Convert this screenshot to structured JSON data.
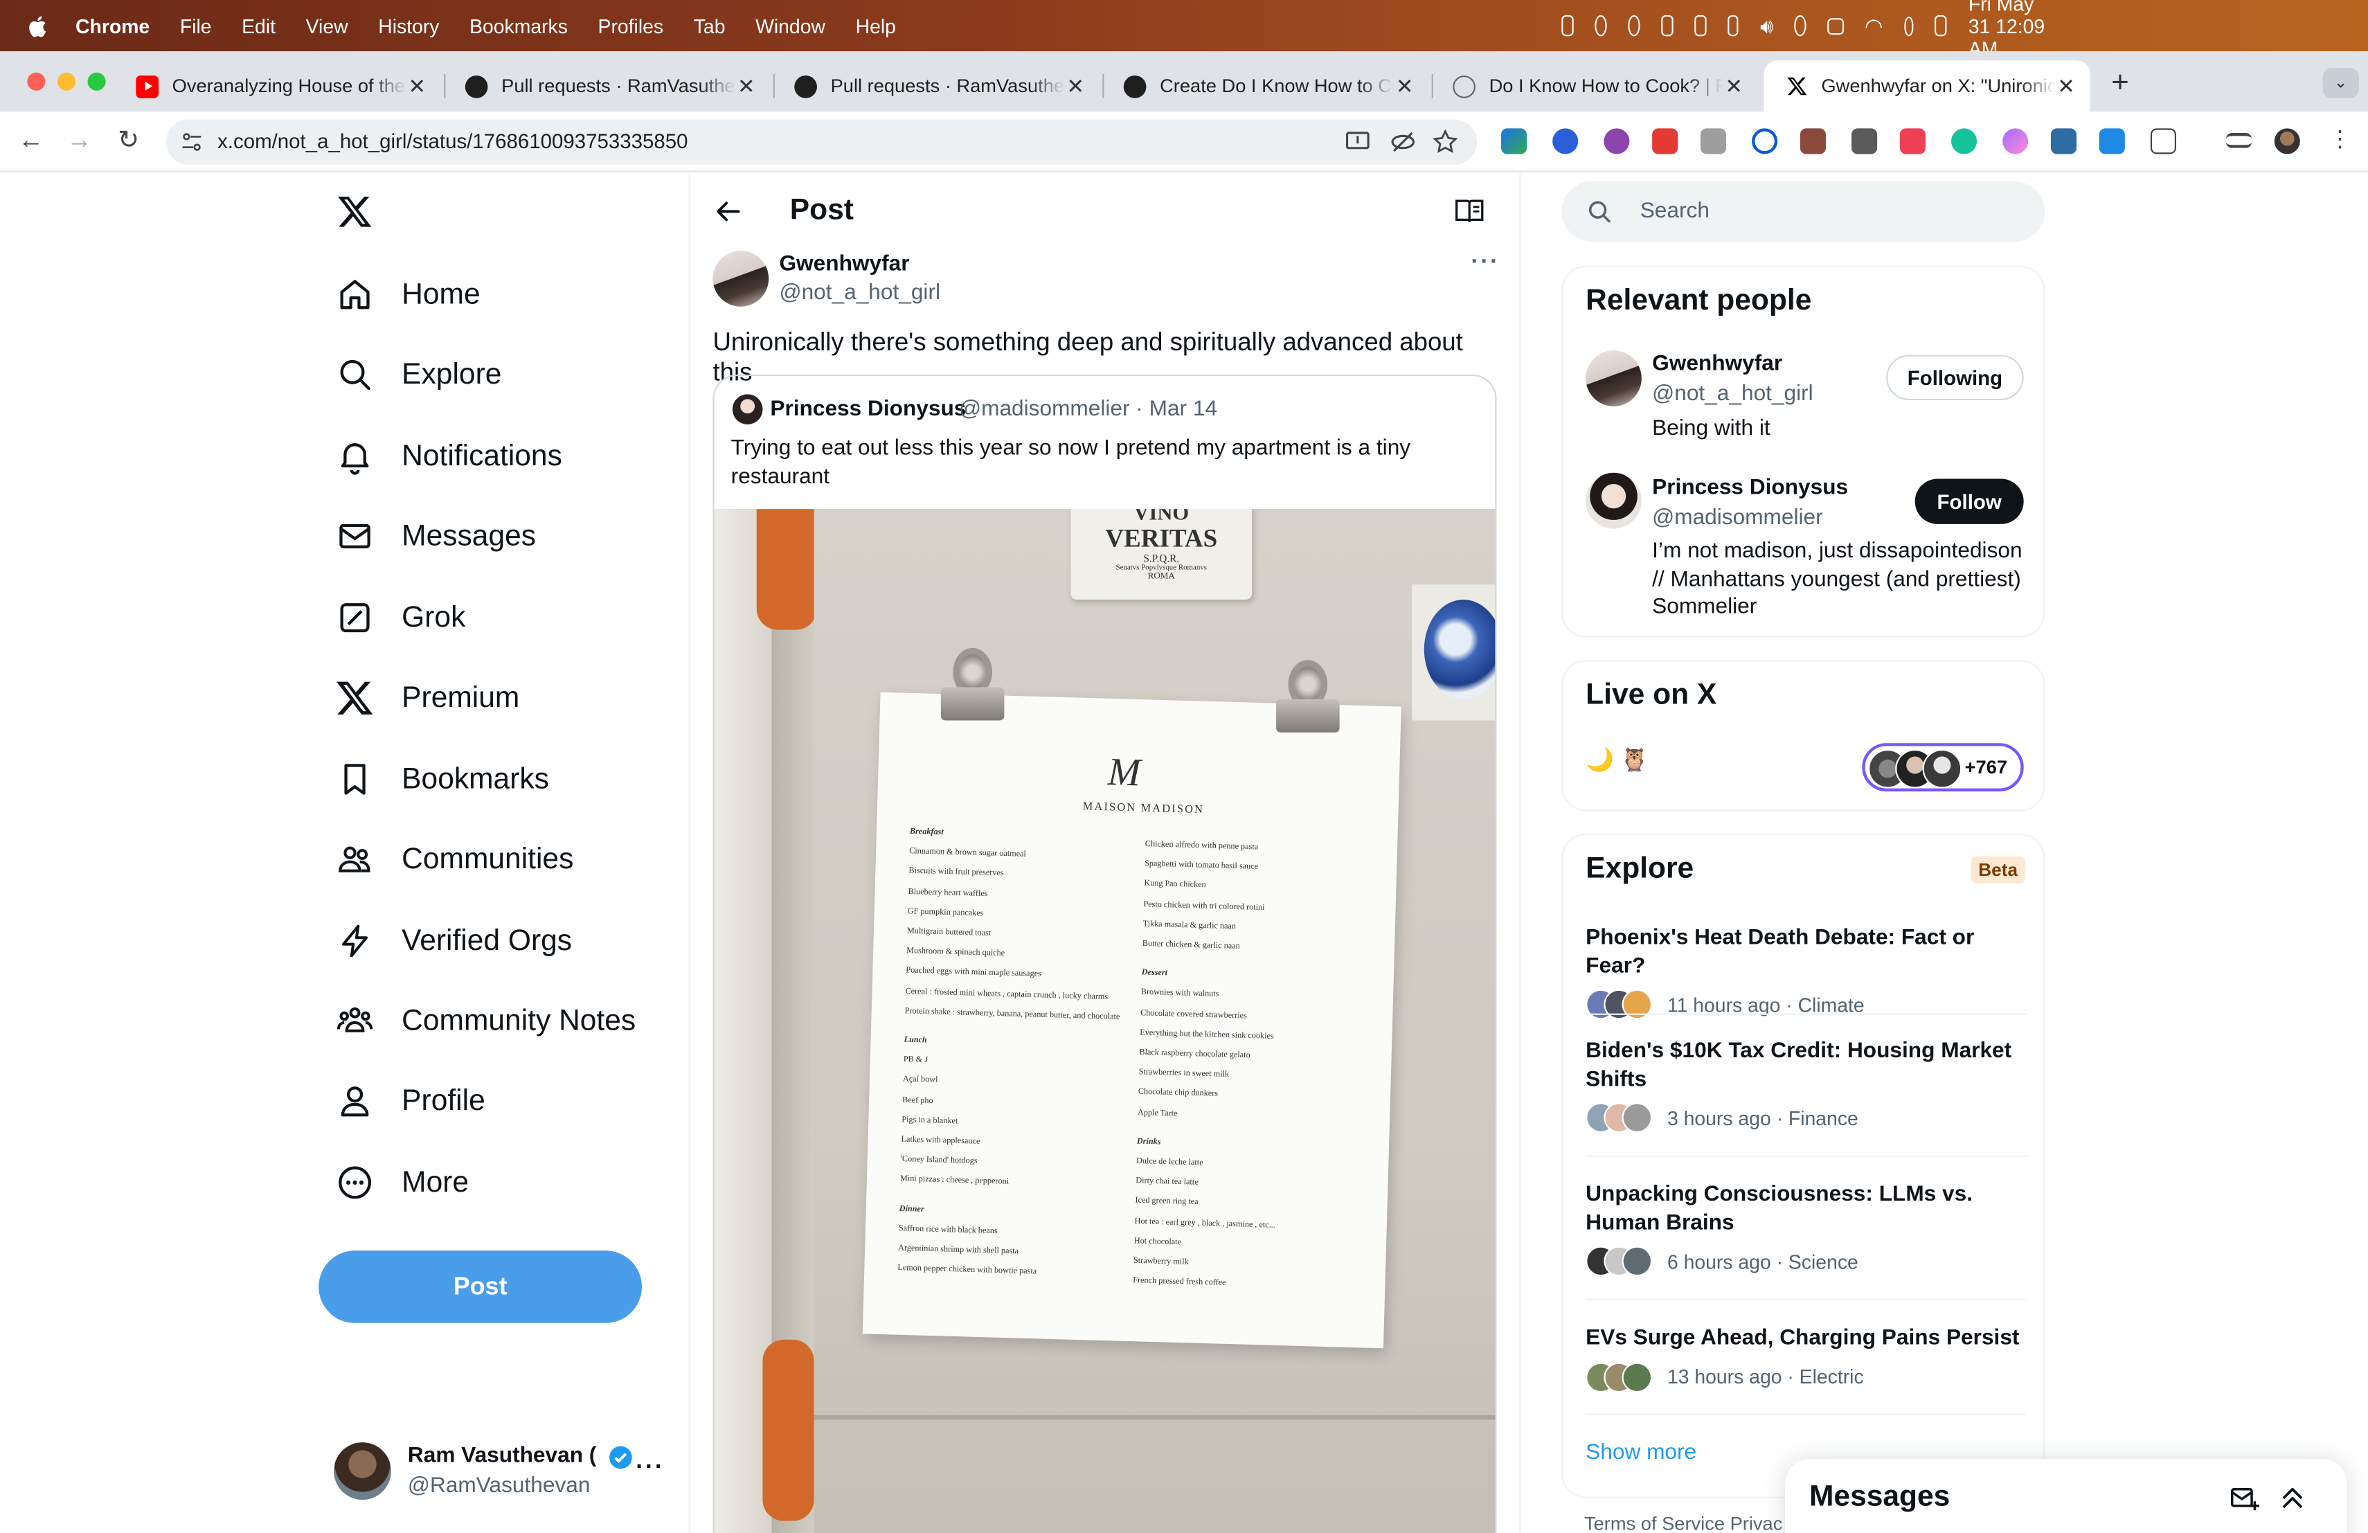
{
  "menubar": {
    "items": [
      "Chrome",
      "File",
      "Edit",
      "View",
      "History",
      "Bookmarks",
      "Profiles",
      "Tab",
      "Window",
      "Help"
    ],
    "datetime": "Fri May 31  12:09 AM"
  },
  "browser": {
    "tabs": [
      {
        "title": "Overanalyzing House of the D",
        "icon": "youtube-icon"
      },
      {
        "title": "Pull requests · RamVasuthevan",
        "icon": "github-icon"
      },
      {
        "title": "Pull requests · RamVasuthevan",
        "icon": "github-icon"
      },
      {
        "title": "Create Do I Know How to Cook",
        "icon": "github-icon"
      },
      {
        "title": "Do I Know How to Cook? | Ram",
        "icon": "globe-icon"
      },
      {
        "title": "Gwenhwyfar on X: \"Unironically",
        "icon": "x-icon"
      }
    ],
    "url": "x.com/not_a_hot_girl/status/1768610093753335850"
  },
  "nav": {
    "items": [
      {
        "label": "Home",
        "icon": "home-icon"
      },
      {
        "label": "Explore",
        "icon": "search-icon"
      },
      {
        "label": "Notifications",
        "icon": "bell-icon"
      },
      {
        "label": "Messages",
        "icon": "mail-icon"
      },
      {
        "label": "Grok",
        "icon": "grok-icon"
      },
      {
        "label": "Premium",
        "icon": "x-icon"
      },
      {
        "label": "Bookmarks",
        "icon": "bookmark-icon"
      },
      {
        "label": "Communities",
        "icon": "communities-icon"
      },
      {
        "label": "Verified Orgs",
        "icon": "lightning-icon"
      },
      {
        "label": "Community Notes",
        "icon": "community-notes-icon"
      },
      {
        "label": "Profile",
        "icon": "person-icon"
      },
      {
        "label": "More",
        "icon": "more-circle-icon"
      }
    ],
    "post_button": "Post",
    "account": {
      "name": "Ram Vasuthevan (",
      "handle": "@RamVasuthevan"
    }
  },
  "post": {
    "header": "Post",
    "author_name": "Gwenhwyfar",
    "author_handle": "@not_a_hot_girl",
    "text": "Unironically there's something deep and spiritually advanced about this",
    "quote": {
      "name": "Princess Dionysus",
      "handle": "@madisommelier · Mar 14",
      "text": "Trying to eat out less this year so now I pretend my apartment is a tiny restaurant"
    },
    "photo": {
      "magnet_line1": "VINO",
      "magnet_line2": "VERITAS",
      "magnet_line3": "S.P.Q.R.",
      "magnet_line4": "Senatvs Popvlvsque Romanvs",
      "magnet_line5": "ROMA",
      "menu_monogram": "M",
      "menu_brand": "MAISON MADISON",
      "col1": [
        {
          "head": "Breakfast"
        },
        {
          "item": "Cinnamon & brown sugar oatmeal"
        },
        {
          "item": "Biscuits with fruit preserves"
        },
        {
          "item": "Blueberry heart waffles"
        },
        {
          "item": "GF pumpkin pancakes"
        },
        {
          "item": "Multigrain buttered toast"
        },
        {
          "item": "Mushroom & spinach quiche"
        },
        {
          "item": "Poached eggs with mini maple sausages"
        },
        {
          "item": "Cereal : frosted mini wheats , captain crunch , lucky charms"
        },
        {
          "item": "Protein shake : strawberry, banana, peanut butter, and chocolate"
        },
        {
          "head": "Lunch"
        },
        {
          "item": "PB & J"
        },
        {
          "item": "Açaí bowl"
        },
        {
          "item": "Beef pho"
        },
        {
          "item": "Pigs in a blanket"
        },
        {
          "item": "Latkes with applesauce"
        },
        {
          "item": "'Coney Island' hotdogs"
        },
        {
          "item": "Mini pizzas : cheese , pepperoni"
        },
        {
          "head": "Dinner"
        },
        {
          "item": "Saffron rice with black beans"
        },
        {
          "item": "Argentinian shrimp with shell pasta"
        },
        {
          "item": "Lemon pepper chicken with bowtie pasta"
        }
      ],
      "col2": [
        {
          "item": "Chicken alfredo with penne pasta"
        },
        {
          "item": "Spaghetti with tomato basil sauce"
        },
        {
          "item": "Kung Pao chicken"
        },
        {
          "item": "Pesto chicken with tri colored rotini"
        },
        {
          "item": "Tikka masala & garlic naan"
        },
        {
          "item": "Butter chicken & garlic naan"
        },
        {
          "head": "Dessert"
        },
        {
          "item": "Brownies with walnuts"
        },
        {
          "item": "Chocolate covered strawberries"
        },
        {
          "item": "Everything but the kitchen sink cookies"
        },
        {
          "item": "Black raspberry chocolate gelato"
        },
        {
          "item": "Strawberries in sweet milk"
        },
        {
          "item": "Chocolate chip dunkers"
        },
        {
          "item": "Apple Tarte"
        },
        {
          "head": "Drinks"
        },
        {
          "item": "Dulce de leche latte"
        },
        {
          "item": "Dirty chai tea latte"
        },
        {
          "item": "Iced green ring tea"
        },
        {
          "item": "Hot tea : earl grey , black , jasmine , etc..."
        },
        {
          "item": "Hot chocolate"
        },
        {
          "item": "Strawberry milk"
        },
        {
          "item": "French pressed fresh coffee"
        }
      ]
    }
  },
  "right": {
    "search_placeholder": "Search",
    "relevant_title": "Relevant people",
    "people": [
      {
        "name": "Gwenhwyfar",
        "handle": "@not_a_hot_girl",
        "bio": "Being with it",
        "button": "Following"
      },
      {
        "name": "Princess Dionysus",
        "handle": "@madisommelier",
        "bio": "I’m not madison, just dissapointedison // Manhattans youngest (and prettiest) Sommelier",
        "button": "Follow"
      }
    ],
    "live_title": "Live on X",
    "live_emoji": "🌙 🦉",
    "live_count": "+767",
    "explore_title": "Explore",
    "explore_badge": "Beta",
    "trends": [
      {
        "title": "Phoenix's Heat Death Debate: Fact or Fear?",
        "meta": "11 hours ago · Climate"
      },
      {
        "title": "Biden's $10K Tax Credit: Housing Market Shifts",
        "meta": "3 hours ago · Finance"
      },
      {
        "title": "Unpacking Consciousness: LLMs vs. Human Brains",
        "meta": "6 hours ago · Science"
      },
      {
        "title": "EVs Surge Ahead, Charging Pains Persist",
        "meta": "13 hours ago · Electric"
      }
    ],
    "show_more": "Show more",
    "footer": "Terms of Service   Privac",
    "messages_title": "Messages"
  },
  "colors": {
    "accent": "#1d9bf0",
    "post_button": "#4a9de9",
    "live_border": "#7856ff"
  }
}
